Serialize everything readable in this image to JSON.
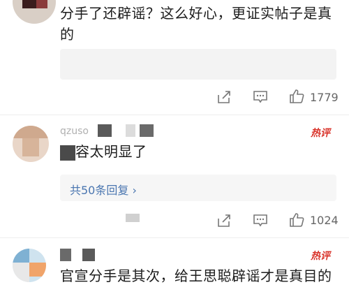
{
  "comment1": {
    "text_line1": "分手了还辟谣？这么好心，更证实帖子是真",
    "text_line2": "的",
    "likes": "1779"
  },
  "comment2": {
    "username": "qzuso",
    "hot_label": "热评",
    "text": "容太明显了",
    "reply_link": "共50条回复 ›",
    "likes": "1024"
  },
  "comment3": {
    "hot_label": "热评",
    "text": "官宣分手是其次，给王思聪辟谣才是真目的"
  },
  "icons": {
    "share": "share-icon",
    "comment": "comment-icon",
    "like": "thumbs-up-icon"
  },
  "colors": {
    "hot": "#d9342b",
    "link": "#4a76b0"
  }
}
